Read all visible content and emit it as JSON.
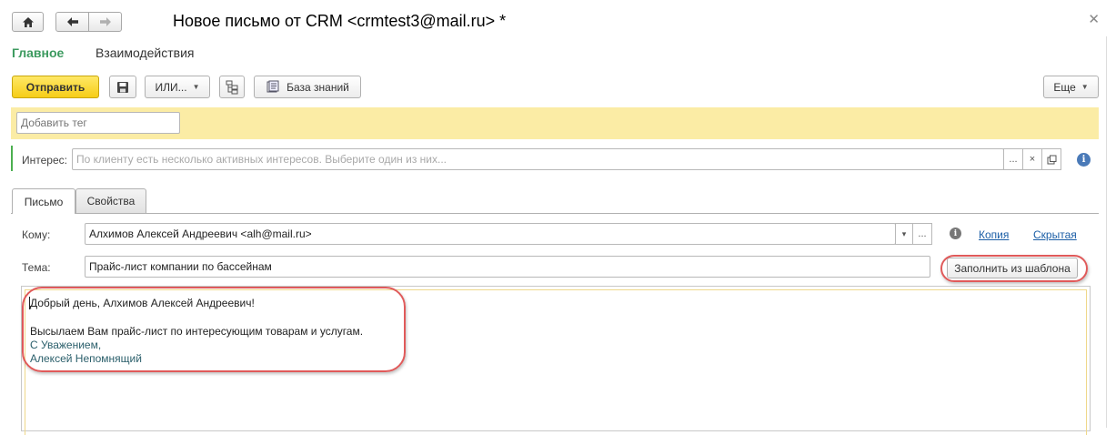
{
  "window": {
    "title": "Новое письмо от CRM <crmtest3@mail.ru> *",
    "close_icon": "close-icon"
  },
  "nav": {
    "home_icon": "home-icon",
    "back_icon": "arrow-left-icon",
    "forward_icon": "arrow-right-icon"
  },
  "sections": [
    {
      "label": "Главное",
      "active": true
    },
    {
      "label": "Взаимодействия",
      "active": false
    }
  ],
  "toolbar": {
    "send_label": "Отправить",
    "save_icon": "floppy-disk-icon",
    "or_label": "ИЛИ...",
    "structure_icon": "structure-icon",
    "knowledge_label": "База знаний",
    "knowledge_icon": "book-icon",
    "more_label": "Еще"
  },
  "tag": {
    "placeholder": "Добавить тег"
  },
  "interest": {
    "label": "Интерес:",
    "placeholder": "По клиенту есть несколько активных интересов. Выберите один из них...",
    "select_button": "...",
    "clear_button": "×",
    "open_icon": "open-icon"
  },
  "tabs": [
    {
      "label": "Письмо",
      "active": true
    },
    {
      "label": "Свойства",
      "active": false
    }
  ],
  "mail": {
    "to_label": "Кому:",
    "to_value": "Алхимов Алексей Андреевич <alh@mail.ru>",
    "to_dropdown": "▾",
    "to_select": "...",
    "copy_link": "Копия",
    "hidden_link": "Скрытая",
    "subject_label": "Тема:",
    "subject_value": "Прайс-лист компании по бассейнам",
    "fill_template_label": "Заполнить из шаблона"
  },
  "body": {
    "lines": [
      "Добрый день, Алхимов Алексей Андреевич!",
      "Высылаем Вам прайс-лист по интересующим товарам и услугам.",
      "С Уважением,",
      "Алексей Непомнящий"
    ]
  },
  "colors": {
    "accent_green": "#3c9a5f",
    "primary_button": "#f6cd17",
    "tag_band": "#fbeca5",
    "highlight_oval": "#e05a5a",
    "link": "#1b5ea6",
    "info_icon": "#4a7ab8"
  }
}
